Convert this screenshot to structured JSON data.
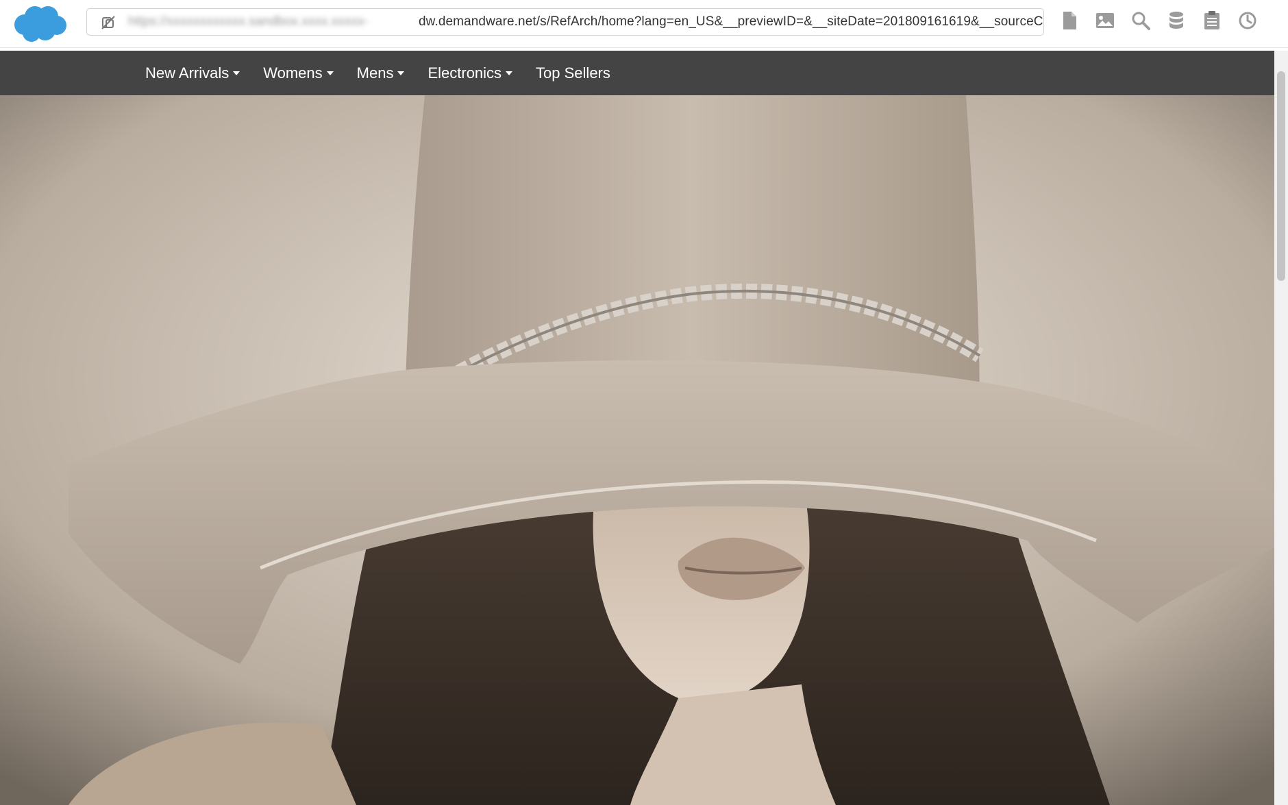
{
  "toolbar": {
    "url_hidden_part": "https://xxxxxxxxxxxx.sandbox.xxxx.xxxxx-",
    "url_visible": "dw.demandware.net/s/RefArch/home?lang=en_US&__previewID=&__siteDate=201809161619&__sourceCode=&__customerGr",
    "icons": [
      "page-icon",
      "image-icon",
      "search-icon",
      "database-icon",
      "clipboard-icon",
      "clock-icon"
    ]
  },
  "nav": {
    "items": [
      {
        "label": "New Arrivals",
        "dropdown": true
      },
      {
        "label": "Womens",
        "dropdown": true
      },
      {
        "label": "Mens",
        "dropdown": true
      },
      {
        "label": "Electronics",
        "dropdown": true
      },
      {
        "label": "Top Sellers",
        "dropdown": false
      }
    ]
  },
  "colors": {
    "brand": "#3b9ddd",
    "nav_bg": "#444444",
    "icon_gray": "#9b9b9b"
  }
}
